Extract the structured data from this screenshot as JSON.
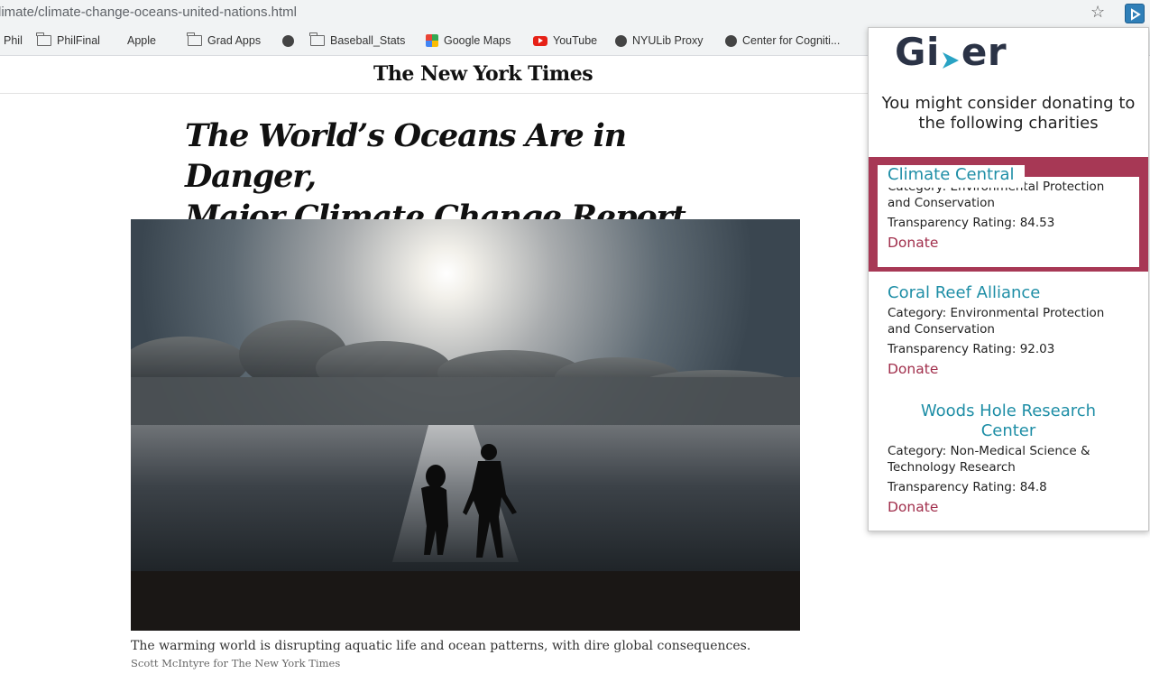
{
  "browser": {
    "url": "limate/climate-change-oceans-united-nations.html",
    "bookmarks": [
      {
        "label": "Phil",
        "icon": "none"
      },
      {
        "label": "PhilFinal",
        "icon": "folder-icon"
      },
      {
        "label": "Apple",
        "icon": "apple-icon"
      },
      {
        "label": "Grad Apps",
        "icon": "folder-icon"
      },
      {
        "label": "",
        "icon": "globe-icon"
      },
      {
        "label": "Baseball_Stats",
        "icon": "folder-icon"
      },
      {
        "label": "Google Maps",
        "icon": "maps-icon"
      },
      {
        "label": "YouTube",
        "icon": "youtube-icon"
      },
      {
        "label": "NYULib Proxy",
        "icon": "globe-icon"
      },
      {
        "label": "Center for Cogniti...",
        "icon": "globe-icon"
      }
    ]
  },
  "article": {
    "masthead": "The New York Times",
    "headline_line1": "The World’s Oceans Are in Danger,",
    "headline_line2": "Major Climate Change Report Warns",
    "caption": "The warming world is disrupting aquatic life and ocean patterns, with dire global consequences.",
    "credit": "Scott McIntyre for The New York Times"
  },
  "extension": {
    "logo_left": "Gi",
    "logo_right": "er",
    "intro_line1": "You might consider donating to",
    "intro_line2": "the following charities",
    "charities": [
      {
        "name": "Climate Central",
        "category_line1": "Category: Environmental Protection",
        "category_line2": "and Conservation",
        "rating": "Transparency Rating: 84.53",
        "donate": "Donate"
      },
      {
        "name": "Coral Reef Alliance",
        "category_line1": "Category: Environmental Protection",
        "category_line2": "and Conservation",
        "rating": "Transparency Rating: 92.03",
        "donate": "Donate"
      },
      {
        "name_line1": "Woods Hole Research",
        "name_line2": "Center",
        "category_line1": "Category: Non-Medical Science &",
        "category_line2": "Technology Research",
        "rating": "Transparency Rating: 84.8",
        "donate": "Donate"
      }
    ],
    "colors": {
      "highlight": "#a73855",
      "name": "#1e8ea6",
      "donate": "#a12f4c",
      "logo": "#2b3346",
      "logo_accent": "#29a3c4"
    }
  }
}
